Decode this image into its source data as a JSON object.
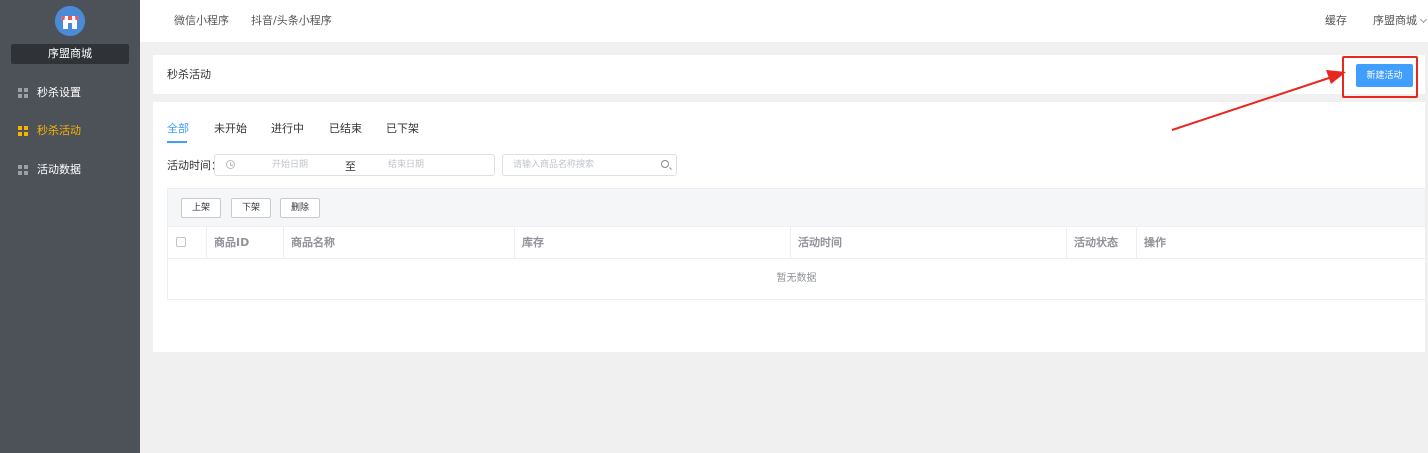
{
  "sidebar": {
    "shop_name": "序盟商城",
    "items": [
      {
        "label": "秒杀设置",
        "active": false
      },
      {
        "label": "秒杀活动",
        "active": true
      },
      {
        "label": "活动数据",
        "active": false
      }
    ]
  },
  "topbar": {
    "tabs": [
      "微信小程序",
      "抖音/头条小程序"
    ],
    "cache_label": "缓存",
    "shop_menu_label": "序盟商城"
  },
  "page": {
    "title": "秒杀活动",
    "new_button_label": "新建活动"
  },
  "filters": {
    "status_tabs": [
      "全部",
      "未开始",
      "进行中",
      "已结束",
      "已下架"
    ],
    "active_tab": "全部",
    "time_label": "活动时间：",
    "start_placeholder": "开始日期",
    "range_separator": "至",
    "end_placeholder": "结束日期",
    "search_placeholder": "请输入商品名称搜索"
  },
  "table": {
    "actions": [
      "上架",
      "下架",
      "删除"
    ],
    "columns": [
      "商品ID",
      "商品名称",
      "库存",
      "活动时间",
      "活动状态",
      "操作"
    ],
    "empty_text": "暂无数据"
  },
  "colors": {
    "sidebar_bg": "#4d5259",
    "accent_active": "#f5b300",
    "primary": "#409eff",
    "annotation": "#e8281e"
  }
}
